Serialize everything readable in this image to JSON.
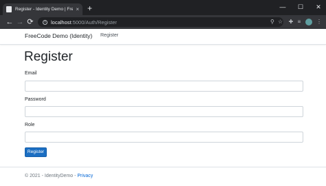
{
  "browser": {
    "tab_title": "Register - Identity Demo | FreeC",
    "tab_close_glyph": "×",
    "new_tab_glyph": "+",
    "window_controls": {
      "minimize": "—",
      "maximize": "☐",
      "close": "✕"
    },
    "url_host": "localhost",
    "url_path": ":5000/Auth/Register",
    "nav": {
      "back": "←",
      "forward": "→",
      "reload": "⟳"
    }
  },
  "navbar": {
    "brand": "FreeCode Demo (Identity)",
    "link_register": "Register"
  },
  "main": {
    "title": "Register",
    "fields": [
      {
        "label": "Email",
        "value": ""
      },
      {
        "label": "Password",
        "value": ""
      },
      {
        "label": "Role",
        "value": ""
      }
    ],
    "submit_label": "Register"
  },
  "footer": {
    "copyright": "© 2021 - IdentityDemo - ",
    "privacy_link": "Privacy"
  },
  "colors": {
    "chrome_dark": "#202124",
    "chrome_toolbar": "#35363a",
    "primary_button": "#1b6ec2",
    "link": "#0366d6"
  }
}
